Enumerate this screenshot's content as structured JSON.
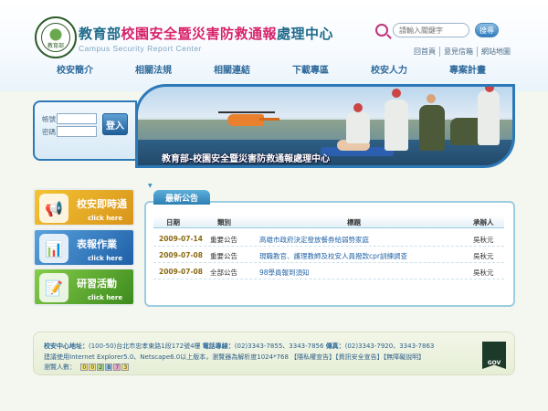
{
  "header": {
    "title_prefix": "教育部",
    "title_highlight": "校園安全暨災害防救通報",
    "title_suffix": "處理中心",
    "subtitle": "Campus Security Report Center",
    "logo_text": "教育部"
  },
  "search": {
    "placeholder": "請輸入關鍵字",
    "button_label": "搜尋"
  },
  "util_links": [
    "回首頁",
    "意見信箱",
    "網站地圖"
  ],
  "main_nav": [
    "校安簡介",
    "相關法規",
    "相關連結",
    "下載專區",
    "校安人力",
    "專案計畫"
  ],
  "login": {
    "account_label": "帳號",
    "password_label": "密碼",
    "button_label": "登入"
  },
  "banner": {
    "caption": "教育部-校園安全暨災害防救通報處理中心"
  },
  "side_buttons": [
    {
      "title": "校安即時通",
      "more": "click here",
      "icon": "megaphone-icon",
      "color": "#f0b52a"
    },
    {
      "title": "表報作業",
      "more": "click here",
      "icon": "chart-icon",
      "color": "#3a86cc"
    },
    {
      "title": "研習活動",
      "more": "click here",
      "icon": "notebook-icon",
      "color": "#68b338"
    }
  ],
  "news": {
    "tab_label": "最新公告",
    "columns": [
      "日期",
      "類別",
      "標題",
      "承辦人"
    ],
    "rows": [
      {
        "date": "2009-07-14",
        "category": "重要公告",
        "title": "高雄市政府決定發放餐券給弱勢家庭",
        "agent": "吳秋元"
      },
      {
        "date": "2009-07-08",
        "category": "重要公告",
        "title": "現職教官、護理教師及校安人員撥款cpr訓練調查",
        "agent": "吳秋元"
      },
      {
        "date": "2009-07-08",
        "category": "全部公告",
        "title": "98學員報到須知",
        "agent": "吳秋元"
      }
    ]
  },
  "footer": {
    "address_label": "校安中心地址：",
    "address": "(100-50)台北市忠孝東路1段172號4樓",
    "phone_label": "電話專線：",
    "phone": "(02)3343-7855、3343-7856",
    "fax_label": "傳真：",
    "fax": "(02)3343-7920、3343-7863",
    "browser_note": "建議使用Internet Explorer5.0、Netscape6.0以上版本，瀏覽器為解析度1024*768 【隱私權宣告】【資訊安全宣告】【無障礙說明】",
    "visitor_label": "瀏覽人數：",
    "visitor_digits": [
      "0",
      "0",
      "2",
      "8",
      "7",
      "3"
    ],
    "gov_badge": "GOV"
  }
}
